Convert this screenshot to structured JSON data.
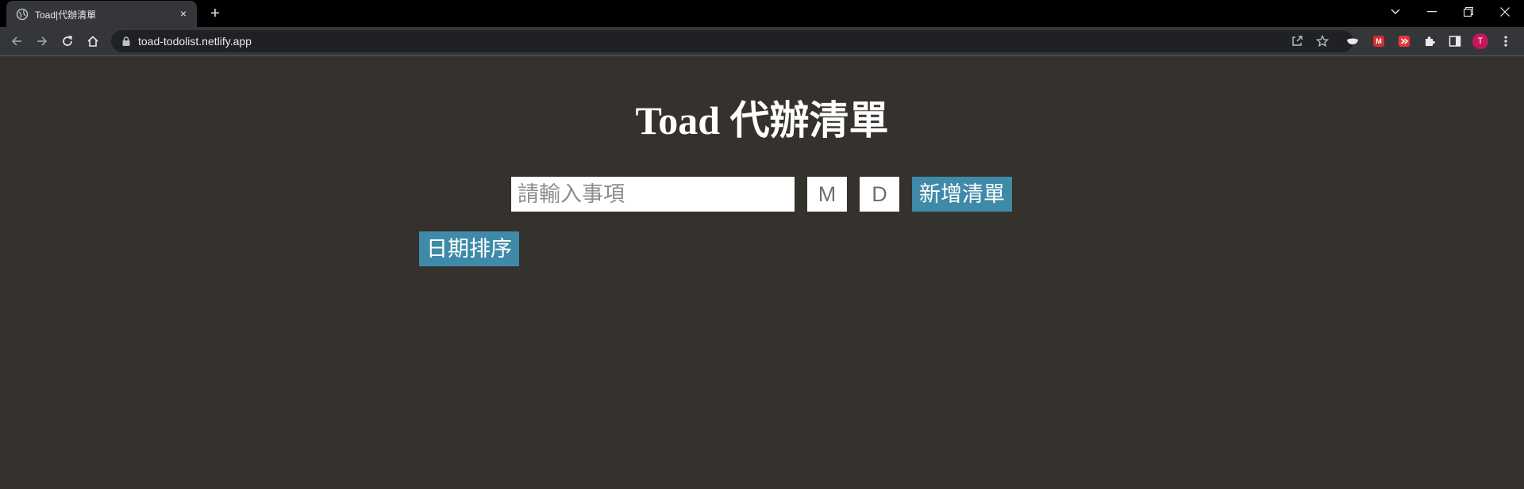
{
  "browser": {
    "tab_title": "Toad|代辦清單",
    "tab_close": "×",
    "new_tab": "+",
    "url": "toad-todolist.netlify.app",
    "profile_initial": "T",
    "extension_badge": "M",
    "icons": [
      "back-icon",
      "forward-icon",
      "reload-icon",
      "home-icon",
      "lock-icon",
      "share-icon",
      "star-icon",
      "extensions-icon",
      "side-panel-icon",
      "menu-icon"
    ]
  },
  "page": {
    "title": "Toad 代辦清單",
    "todo_placeholder": "請輸入事項",
    "month_placeholder": "M",
    "day_placeholder": "D",
    "add_button": "新增清單",
    "sort_button": "日期排序"
  },
  "colors": {
    "background": "#35312c",
    "button": "#3f8aa8",
    "title": "#ffffff"
  }
}
